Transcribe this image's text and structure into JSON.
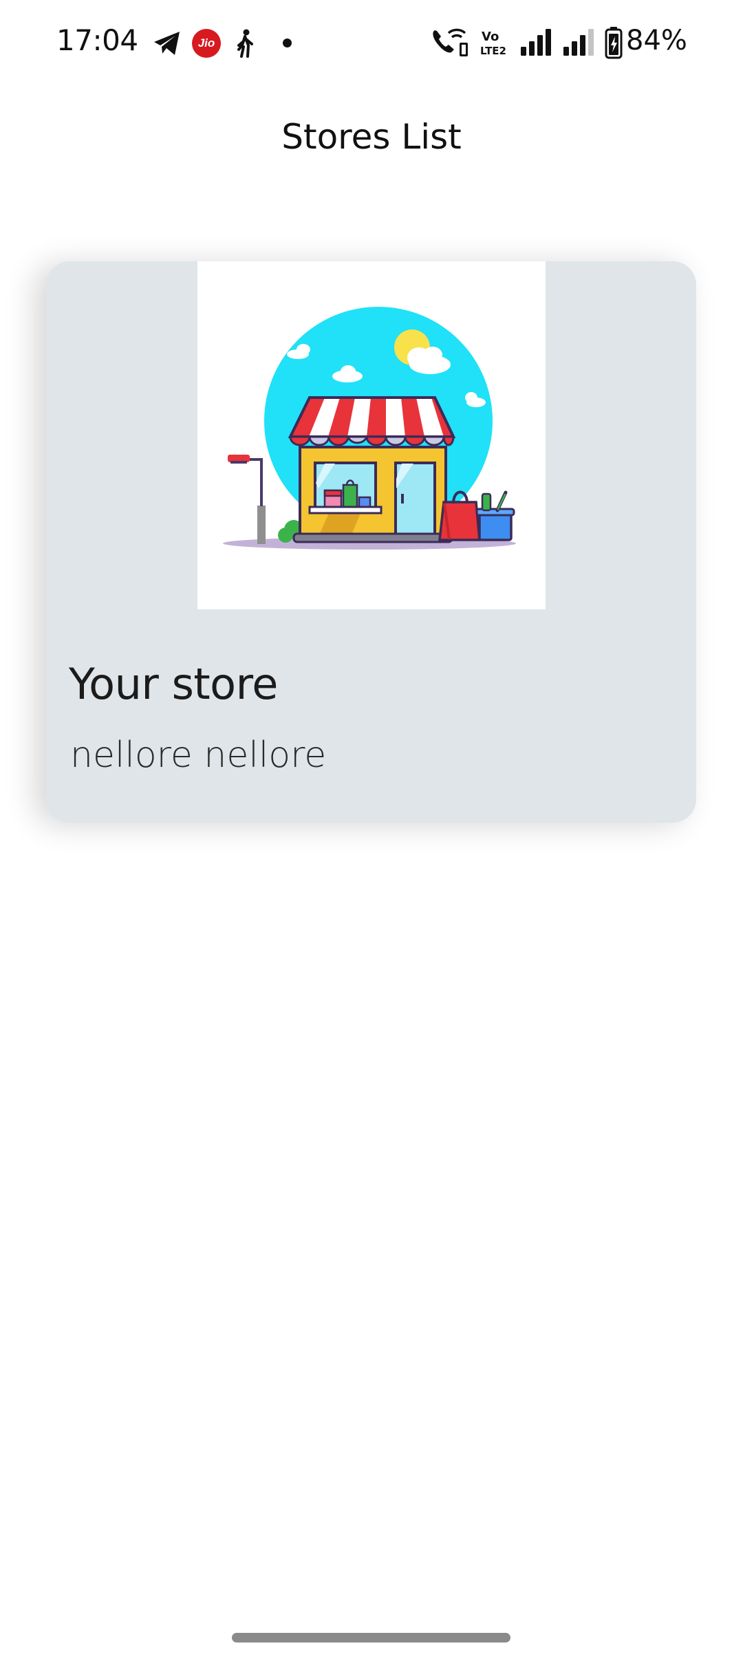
{
  "status_bar": {
    "time": "17:04",
    "jio_label": "Jio",
    "battery_percent": "84%",
    "left_icons": [
      "telegram-icon",
      "jio-icon",
      "walking-icon",
      "dot-icon"
    ],
    "right_icons": [
      "wifi-calling-icon",
      "volte-icon",
      "signal-icon",
      "signal-icon",
      "battery-charging-icon"
    ]
  },
  "header": {
    "title": "Stores List"
  },
  "stores": [
    {
      "name": "Your store",
      "address": "nellore nellore",
      "image_icon": "storefront-illustration"
    }
  ],
  "colors": {
    "card_background": "#dfe5e8",
    "page_background": "#ffffff",
    "awning_red": "#e8333b",
    "sky_blue": "#22dff5",
    "shop_yellow": "#f5c431"
  }
}
